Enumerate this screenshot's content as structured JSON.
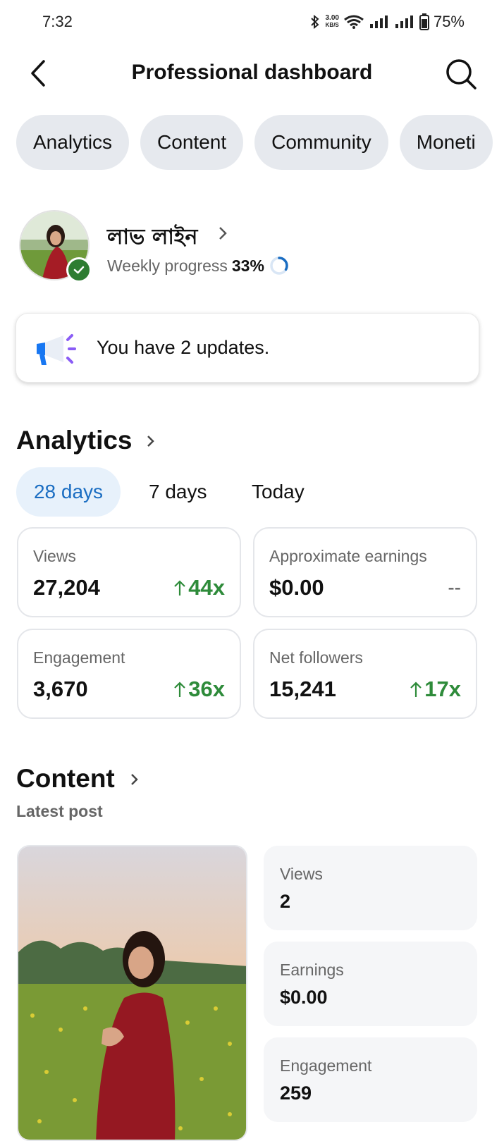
{
  "status_bar": {
    "time": "7:32",
    "net_speed_value": "3.00",
    "net_speed_unit": "KB/S",
    "battery": "75%"
  },
  "header": {
    "title": "Professional dashboard"
  },
  "tabs": [
    {
      "label": "Analytics"
    },
    {
      "label": "Content"
    },
    {
      "label": "Community"
    },
    {
      "label": "Moneti"
    }
  ],
  "profile": {
    "name": "লাভ লাইন",
    "progress_label": "Weekly progress",
    "progress_value": "33%",
    "progress_fraction": 0.33
  },
  "updates": {
    "text": "You have 2 updates."
  },
  "analytics": {
    "title": "Analytics",
    "periods": [
      {
        "label": "28 days",
        "active": true
      },
      {
        "label": "7 days",
        "active": false
      },
      {
        "label": "Today",
        "active": false
      }
    ],
    "stats": [
      {
        "label": "Views",
        "value": "27,204",
        "delta": "44x"
      },
      {
        "label": "Approximate earnings",
        "value": "$0.00",
        "delta": "--"
      },
      {
        "label": "Engagement",
        "value": "3,670",
        "delta": "36x"
      },
      {
        "label": "Net followers",
        "value": "15,241",
        "delta": "17x"
      }
    ]
  },
  "content": {
    "title": "Content",
    "subtitle": "Latest post",
    "metrics": [
      {
        "label": "Views",
        "value": "2"
      },
      {
        "label": "Earnings",
        "value": "$0.00"
      },
      {
        "label": "Engagement",
        "value": "259"
      }
    ]
  },
  "colors": {
    "accent_blue": "#1a6dc2",
    "positive_green": "#2e8b3a",
    "chip_background": "#e6e9ee",
    "verified_green": "#2e7d32"
  }
}
